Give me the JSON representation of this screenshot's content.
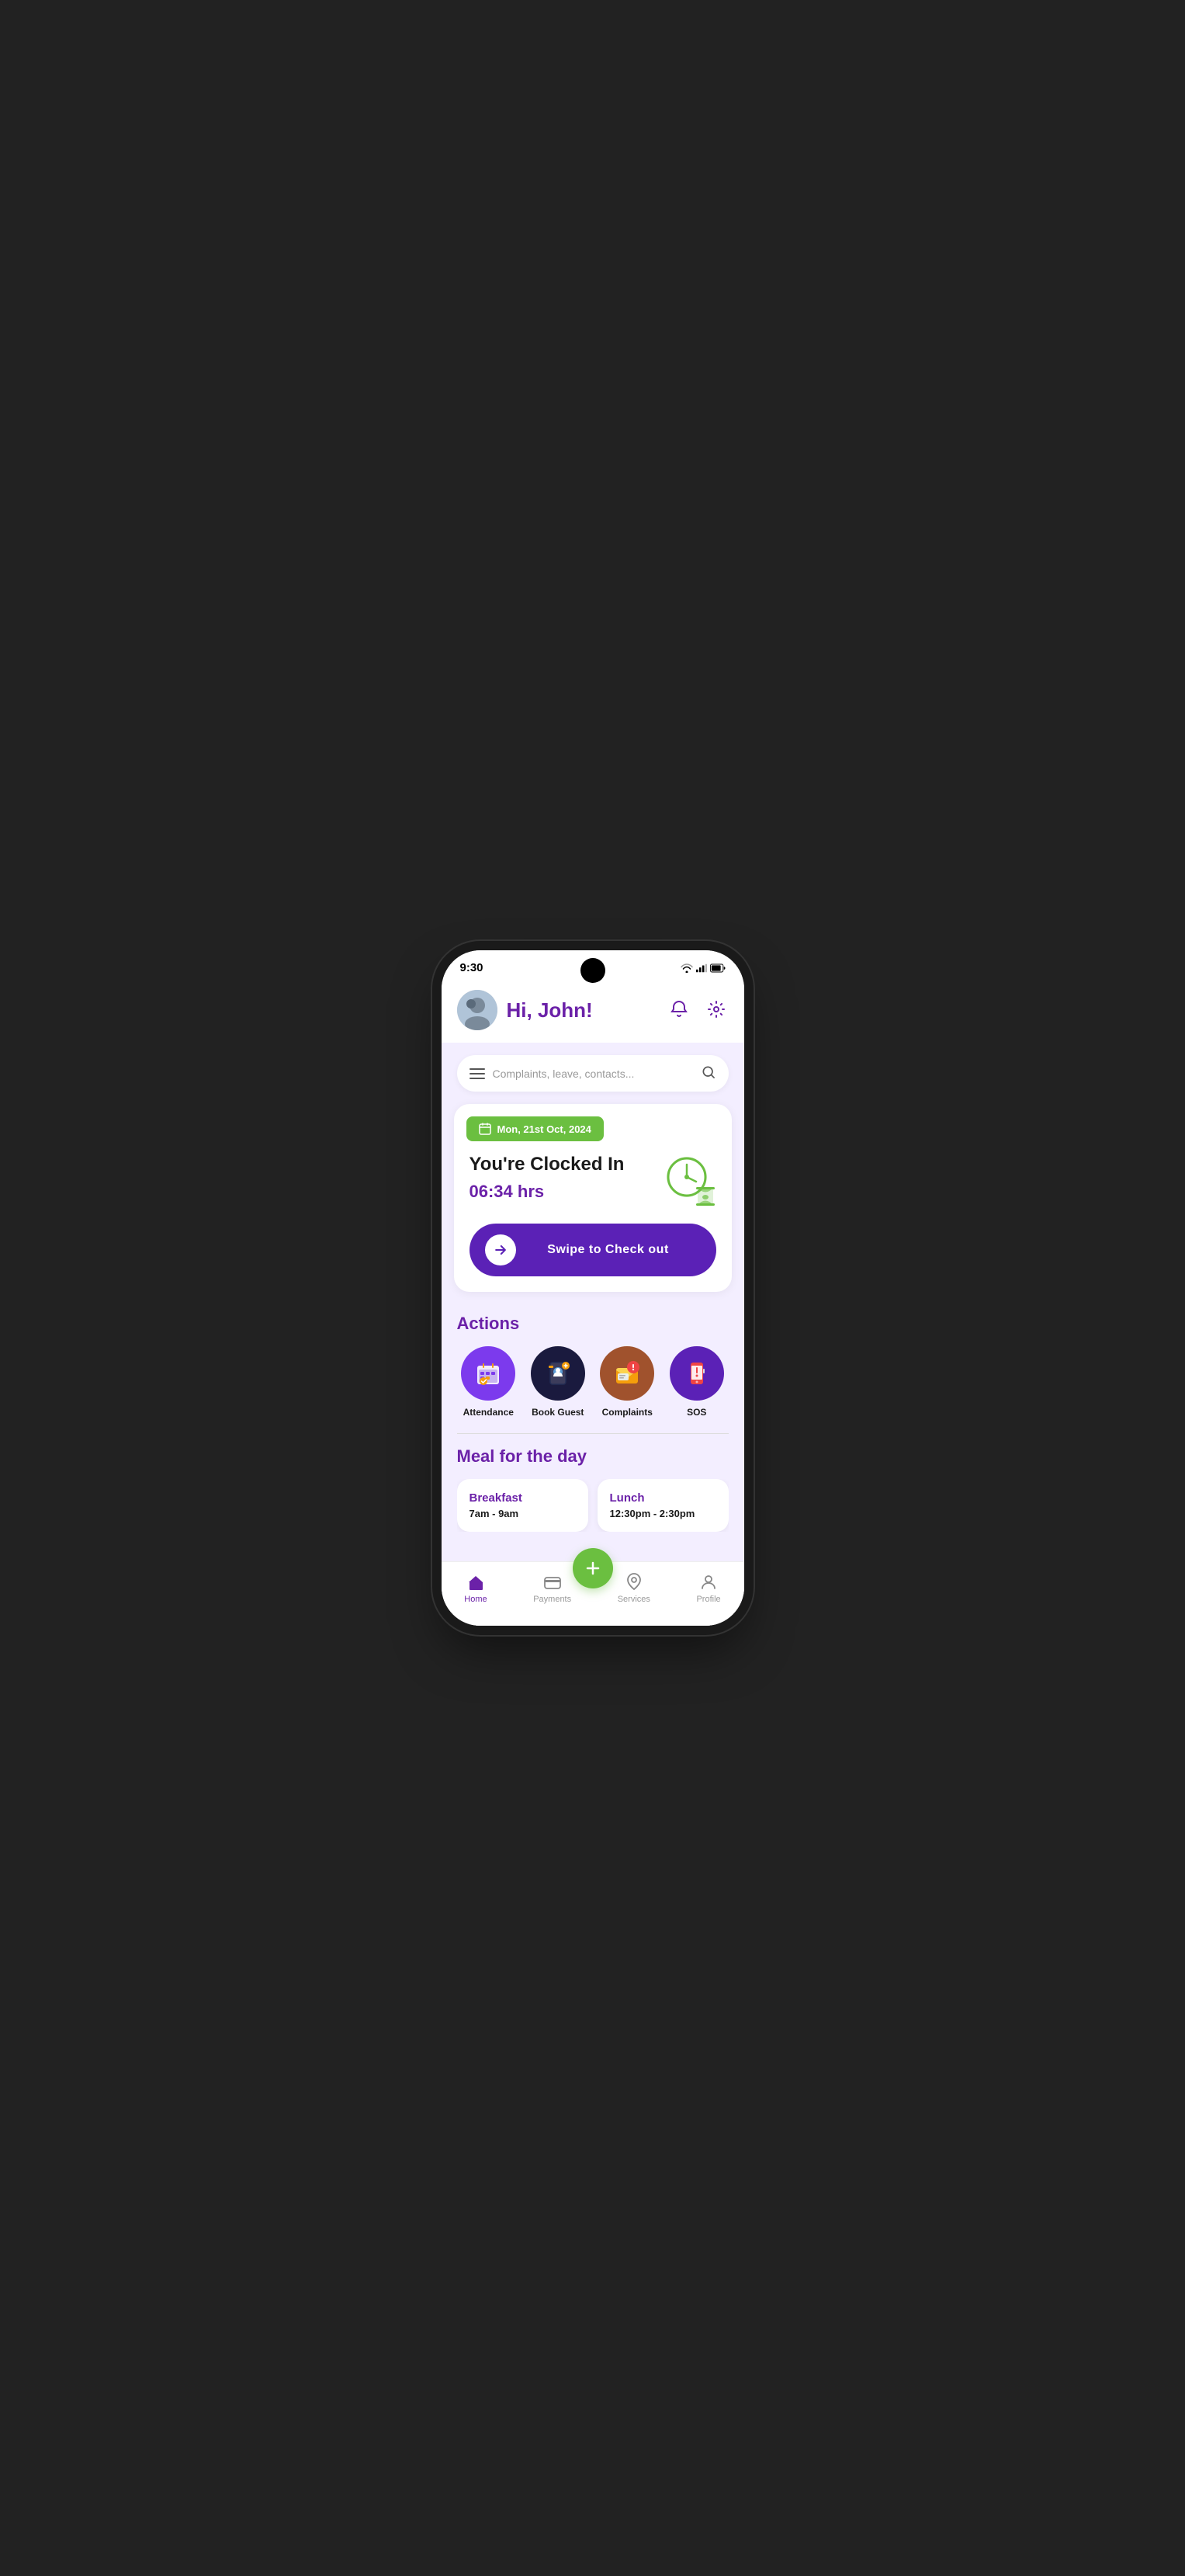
{
  "status_bar": {
    "time": "9:30"
  },
  "header": {
    "greeting": "Hi, John!",
    "notification_icon": "bell-icon",
    "settings_icon": "gear-icon"
  },
  "search_bar": {
    "placeholder": "Complaints, leave, contacts..."
  },
  "clock_card": {
    "date": "Mon, 21st Oct, 2024",
    "status": "You're Clocked In",
    "hours": "06:34 hrs",
    "swipe_label": "Swipe to Check out"
  },
  "actions_section": {
    "title": "Actions",
    "items": [
      {
        "label": "Attendance",
        "color": "#7C3AED"
      },
      {
        "label": "Book Guest",
        "color": "#1a1a3e"
      },
      {
        "label": "Complaints",
        "color": "#c47230"
      },
      {
        "label": "SOS",
        "color": "#5B21B6"
      }
    ]
  },
  "meal_section": {
    "title": "Meal for the day",
    "meals": [
      {
        "name": "Breakfast",
        "time": "7am - 9am"
      },
      {
        "name": "Lunch",
        "time": "12:30pm - 2:30pm"
      }
    ]
  },
  "bottom_nav": {
    "items": [
      {
        "label": "Home",
        "active": true
      },
      {
        "label": "Payments",
        "active": false
      },
      {
        "label": "Services",
        "active": false
      },
      {
        "label": "Profile",
        "active": false
      }
    ]
  }
}
